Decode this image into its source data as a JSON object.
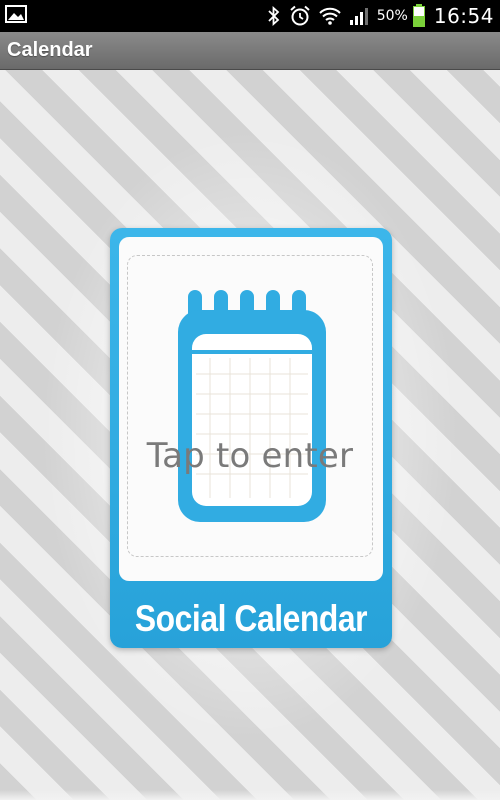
{
  "status_bar": {
    "icons": [
      "gallery-icon",
      "bluetooth-icon",
      "alarm-icon",
      "wifi-icon",
      "signal-icon",
      "battery-icon"
    ],
    "battery_percent": "50%",
    "time": "16:54",
    "battery_level": 0.5
  },
  "action_bar": {
    "title": "Calendar"
  },
  "app_tile": {
    "label": "Social Calendar",
    "accent_color": "#31ace2",
    "icon": "notepad-icon"
  },
  "overlay": {
    "tap_text": "Tap to enter"
  }
}
